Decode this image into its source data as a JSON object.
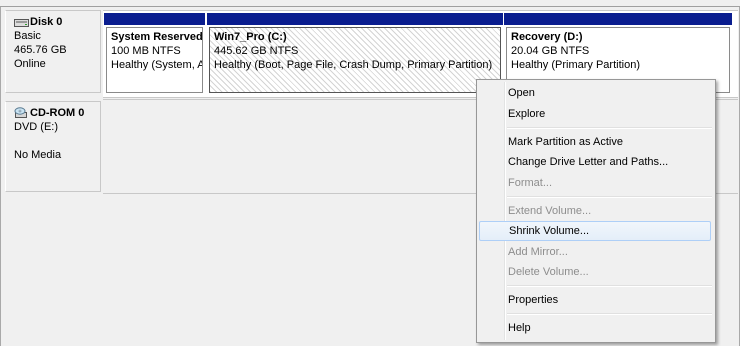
{
  "disk0": {
    "title": "Disk 0",
    "type": "Basic",
    "size": "465.76 GB",
    "status": "Online",
    "partitions": [
      {
        "name": "System Reserved",
        "size": "100 MB NTFS",
        "status": "Healthy (System, A"
      },
      {
        "name": "Win7_Pro  (C:)",
        "size": "445.62 GB NTFS",
        "status": "Healthy (Boot, Page File, Crash Dump, Primary Partition)"
      },
      {
        "name": "Recovery  (D:)",
        "size": "20.04 GB NTFS",
        "status": "Healthy (Primary Partition)"
      }
    ]
  },
  "cdrom0": {
    "title": "CD-ROM 0",
    "type": "DVD (E:)",
    "media": "No Media"
  },
  "context_menu": {
    "items": [
      {
        "label": "Open",
        "enabled": true
      },
      {
        "label": "Explore",
        "enabled": true
      },
      {
        "label": "Mark Partition as Active",
        "enabled": true
      },
      {
        "label": "Change Drive Letter and Paths...",
        "enabled": true
      },
      {
        "label": "Format...",
        "enabled": false
      },
      {
        "label": "Extend Volume...",
        "enabled": false
      },
      {
        "label": "Shrink Volume...",
        "enabled": true,
        "highlighted": true
      },
      {
        "label": "Add Mirror...",
        "enabled": false
      },
      {
        "label": "Delete Volume...",
        "enabled": false
      },
      {
        "label": "Properties",
        "enabled": true
      },
      {
        "label": "Help",
        "enabled": true
      }
    ]
  },
  "colors": {
    "partition_bar": "#0a1d8f",
    "menu_highlight_border": "#aecff7",
    "disabled_text": "#8d8d8d"
  },
  "icons": {
    "disk": "hard-disk-icon",
    "cdrom": "cd-drive-icon"
  }
}
